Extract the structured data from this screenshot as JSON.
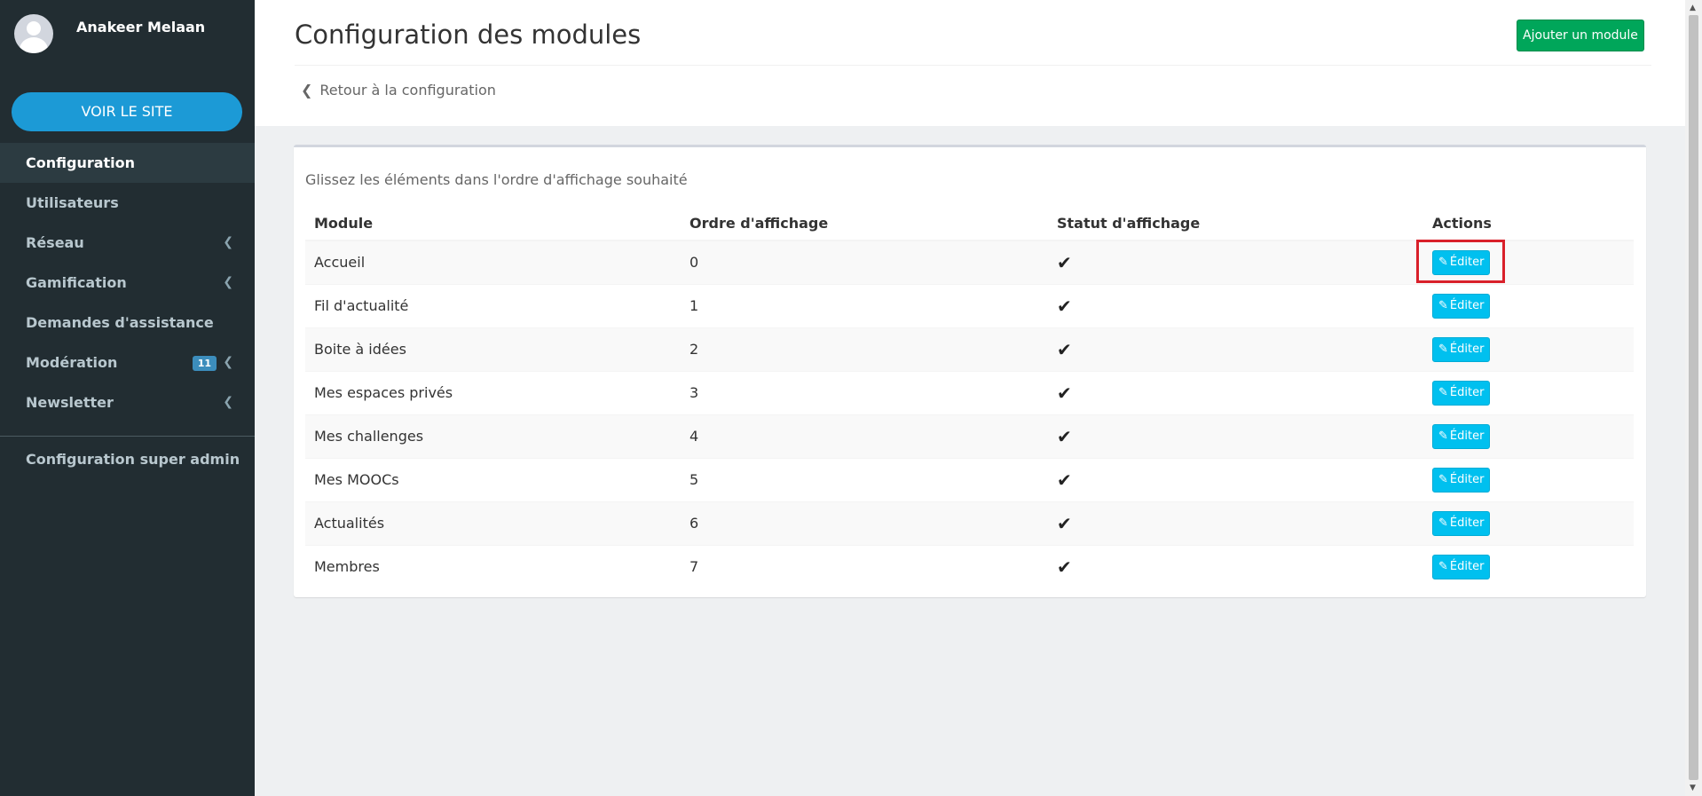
{
  "user": {
    "name": "Anakeer Melaan"
  },
  "sidebar": {
    "visit_site": "VOIR LE SITE",
    "items": [
      {
        "label": "Configuration",
        "active": true,
        "chevron": false,
        "badge": ""
      },
      {
        "label": "Utilisateurs",
        "active": false,
        "chevron": false,
        "badge": ""
      },
      {
        "label": "Réseau",
        "active": false,
        "chevron": true,
        "badge": ""
      },
      {
        "label": "Gamification",
        "active": false,
        "chevron": true,
        "badge": ""
      },
      {
        "label": "Demandes d'assistance",
        "active": false,
        "chevron": false,
        "badge": ""
      },
      {
        "label": "Modération",
        "active": false,
        "chevron": true,
        "badge": "11"
      },
      {
        "label": "Newsletter",
        "active": false,
        "chevron": true,
        "badge": ""
      }
    ],
    "super_admin": "Configuration super admin"
  },
  "header": {
    "title": "Configuration des modules",
    "add_button": "Ajouter un module",
    "back_link": "Retour à la configuration"
  },
  "table": {
    "hint": "Glissez les éléments dans l'ordre d'affichage souhaité",
    "columns": [
      "Module",
      "Ordre d'affichage",
      "Statut d'affichage",
      "Actions"
    ],
    "edit_label": "Éditer",
    "rows": [
      {
        "module": "Accueil",
        "order": "0",
        "status": "✔"
      },
      {
        "module": "Fil d'actualité",
        "order": "1",
        "status": "✔"
      },
      {
        "module": "Boite à idées",
        "order": "2",
        "status": "✔"
      },
      {
        "module": "Mes espaces privés",
        "order": "3",
        "status": "✔"
      },
      {
        "module": "Mes challenges",
        "order": "4",
        "status": "✔"
      },
      {
        "module": "Mes MOOCs",
        "order": "5",
        "status": "✔"
      },
      {
        "module": "Actualités",
        "order": "6",
        "status": "✔"
      },
      {
        "module": "Membres",
        "order": "7",
        "status": "✔"
      }
    ]
  },
  "colors": {
    "sidebar_bg": "#222d32",
    "accent_blue": "#1c9ad6",
    "add_green": "#00a65a",
    "edit_cyan": "#00c0ef",
    "highlight_red": "#d9202a"
  }
}
